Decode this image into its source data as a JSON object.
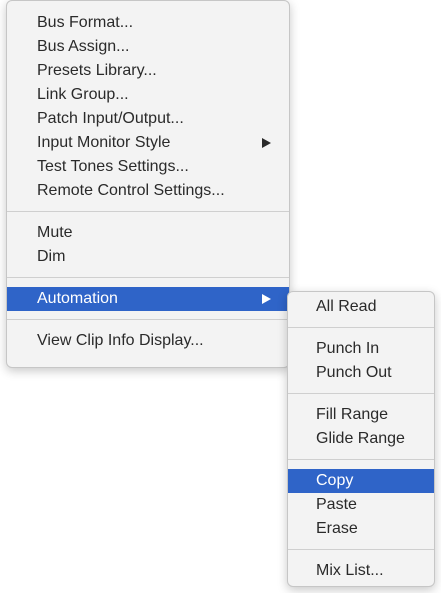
{
  "main_menu": {
    "items": [
      {
        "label": "Bus Format..."
      },
      {
        "label": "Bus Assign..."
      },
      {
        "label": "Presets Library..."
      },
      {
        "label": "Link Group..."
      },
      {
        "label": "Patch Input/Output..."
      },
      {
        "label": "Input Monitor Style",
        "has_submenu": true
      },
      {
        "label": "Test Tones Settings..."
      },
      {
        "label": "Remote Control Settings..."
      },
      {
        "label": "Mute"
      },
      {
        "label": "Dim"
      },
      {
        "label": "Automation",
        "has_submenu": true,
        "highlighted": true
      },
      {
        "label": "View Clip Info Display..."
      }
    ]
  },
  "automation_submenu": {
    "items": [
      {
        "label": "All Read"
      },
      {
        "label": "Punch In"
      },
      {
        "label": "Punch Out"
      },
      {
        "label": "Fill Range"
      },
      {
        "label": "Glide Range"
      },
      {
        "label": "Copy",
        "highlighted": true
      },
      {
        "label": "Paste"
      },
      {
        "label": "Erase"
      },
      {
        "label": "Mix List..."
      }
    ]
  },
  "colors": {
    "highlight": "#2f64c8",
    "menu_background": "#f3f3f3",
    "text": "#2a2a2a"
  }
}
